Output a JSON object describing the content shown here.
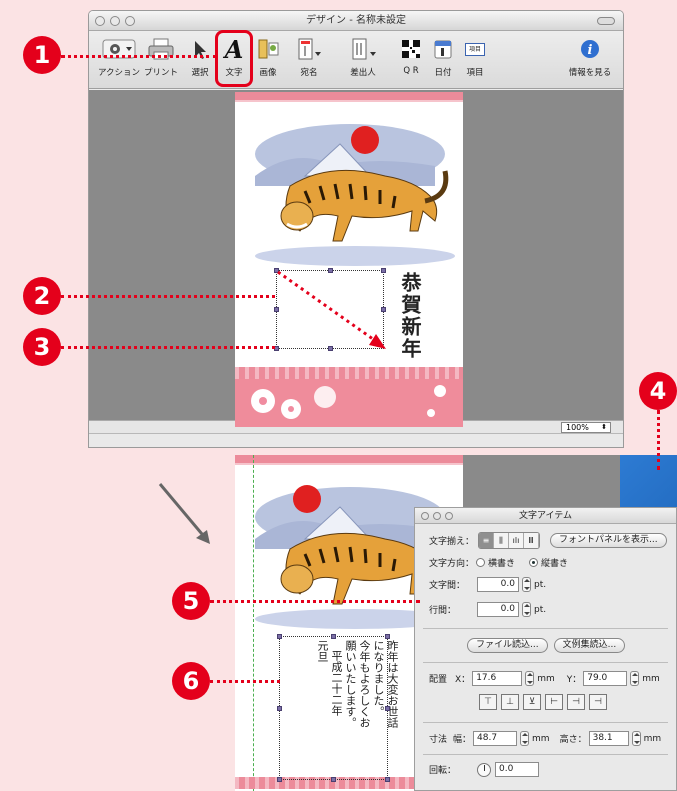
{
  "window": {
    "title": "デザイン - 名称未設定"
  },
  "toolbar": {
    "action": "アクション",
    "print": "プリント",
    "select": "選択",
    "text": "文字",
    "image": "画像",
    "address": "宛名",
    "sender": "差出人",
    "qr": "Q R",
    "date": "日付",
    "item": "項目",
    "item_icon_text": "項目",
    "info": "情報を見る"
  },
  "status": {
    "zoom": "100%"
  },
  "card": {
    "greeting": "恭賀新年",
    "message_lines": [
      "昨年は大変お世話",
      "になりました。",
      "今年もよろしくお",
      "願いいたします。",
      "平成二十二年",
      "元旦"
    ]
  },
  "callouts": [
    "1",
    "2",
    "3",
    "4",
    "5",
    "6"
  ],
  "palette": {
    "title": "文字アイテム",
    "align_label": "文字揃え：",
    "align_options": [
      "≡",
      "⫼",
      "ılı",
      "Ⅲ"
    ],
    "font_panel_button": "フォントパネルを表示...",
    "direction_label": "文字方向：",
    "horizontal": "横書き",
    "vertical": "縦書き",
    "char_spacing_label": "文字間：",
    "char_spacing_value": "0.0",
    "line_spacing_label": "行間：",
    "line_spacing_value": "0.0",
    "unit_pt": "pt.",
    "file_load_button": "ファイル読込...",
    "sample_load_button": "文例集読込...",
    "position_label": "配置",
    "x_label": "X：",
    "x_value": "17.6",
    "y_label": "Y：",
    "y_value": "79.0",
    "unit_mm": "mm",
    "size_label": "寸法",
    "width_label": "幅：",
    "width_value": "48.7",
    "height_label": "高さ：",
    "height_value": "38.1",
    "rotation_label": "回転：",
    "rotation_value": "0.0"
  },
  "colors": {
    "callout": "#e4001b",
    "card_pink": "#ef8c9b",
    "canvas": "#8a8a8a"
  }
}
